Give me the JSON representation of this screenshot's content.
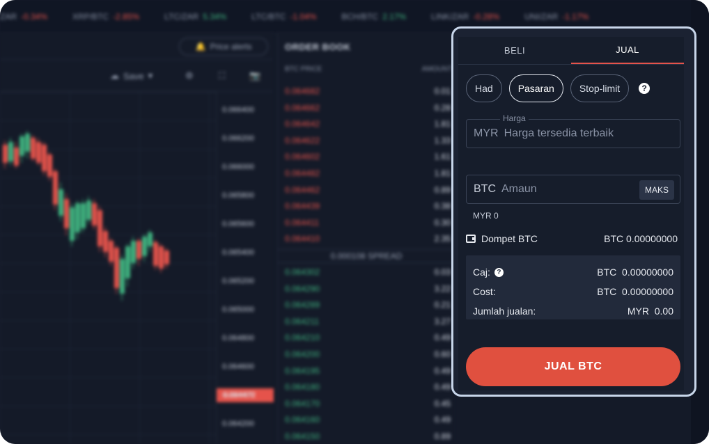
{
  "ticker": [
    {
      "pair": "ZAR",
      "change": "-0.34%",
      "dir": "neg"
    },
    {
      "pair": "XRP/BTC",
      "change": "-2.85%",
      "dir": "neg"
    },
    {
      "pair": "LTC/ZAR",
      "change": "5.34%",
      "dir": "pos"
    },
    {
      "pair": "LTC/BTC",
      "change": "-1.04%",
      "dir": "neg"
    },
    {
      "pair": "BCH/BTC",
      "change": "2.17%",
      "dir": "pos"
    },
    {
      "pair": "LINK/ZAR",
      "change": "-0.28%",
      "dir": "neg"
    },
    {
      "pair": "UNI/ZAR",
      "change": "-1.17%",
      "dir": "neg"
    }
  ],
  "chart": {
    "price_alerts_label": "Price alerts",
    "save_label": "Save",
    "y_ticks": [
      "0.066400",
      "0.066200",
      "0.066000",
      "0.065800",
      "0.065600",
      "0.065400",
      "0.065200",
      "0.065000",
      "0.064800",
      "0.064600",
      "0.064400",
      "0.064200"
    ],
    "last_price": "0.064472"
  },
  "orderbook": {
    "title": "ORDER BOOK",
    "col_price": "BTC PRICE",
    "col_amount": "AMOUNT",
    "asks": [
      {
        "price": "0.064682",
        "amount": "0.01"
      },
      {
        "price": "0.064662",
        "amount": "0.28"
      },
      {
        "price": "0.064642",
        "amount": "1.81"
      },
      {
        "price": "0.064622",
        "amount": "1.33"
      },
      {
        "price": "0.064602",
        "amount": "1.61"
      },
      {
        "price": "0.064482",
        "amount": "1.81"
      },
      {
        "price": "0.064462",
        "amount": "0.89"
      },
      {
        "price": "0.064439",
        "amount": "0.38"
      },
      {
        "price": "0.064411",
        "amount": "0.30"
      },
      {
        "price": "0.064410",
        "amount": "2.35"
      }
    ],
    "spread": "0.000108 SPREAD",
    "bids": [
      {
        "price": "0.064302",
        "amount": "0.03"
      },
      {
        "price": "0.064290",
        "amount": "3.22"
      },
      {
        "price": "0.064289",
        "amount": "0.21"
      },
      {
        "price": "0.064211",
        "amount": "3.27"
      },
      {
        "price": "0.064210",
        "amount": "0.49"
      },
      {
        "price": "0.064200",
        "amount": "0.60"
      },
      {
        "price": "0.064195",
        "amount": "0.49"
      },
      {
        "price": "0.064180",
        "amount": "0.49"
      },
      {
        "price": "0.064170",
        "amount": "0.45"
      },
      {
        "price": "0.064160",
        "amount": "0.49"
      },
      {
        "price": "0.064150",
        "amount": "0.89"
      }
    ]
  },
  "trade": {
    "tabs": [
      "BELI",
      "JUAL"
    ],
    "active_tab": "JUAL",
    "order_types": [
      "Had",
      "Pasaran",
      "Stop-limit"
    ],
    "selected_order_type": "Pasaran",
    "price": {
      "label": "Harga",
      "unit": "MYR",
      "placeholder": "Harga tersedia terbaik"
    },
    "amount": {
      "unit": "BTC",
      "placeholder": "Amaun",
      "max_label": "MAKS"
    },
    "myr_hint": "MYR 0",
    "wallet": {
      "label": "Dompet BTC",
      "value": "BTC 0.00000000"
    },
    "fees": [
      {
        "label": "Caj:",
        "has_help": true,
        "value": "BTC  0.00000000"
      },
      {
        "label": "Cost:",
        "has_help": false,
        "value": "BTC  0.00000000"
      },
      {
        "label": "Jumlah jualan:",
        "has_help": false,
        "value": "MYR  0.00"
      }
    ],
    "submit_label": "JUAL BTC"
  },
  "colors": {
    "accent": "#e0503f",
    "ask": "#e5534b",
    "bid": "#3fb27f",
    "background": "#141a28"
  }
}
